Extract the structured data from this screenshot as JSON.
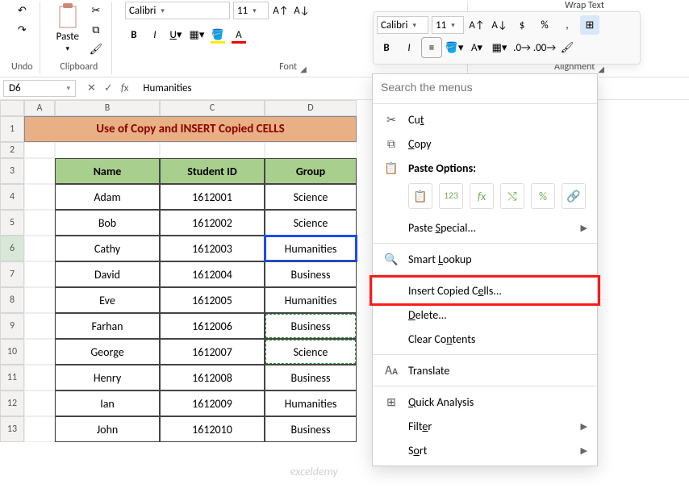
{
  "ribbon": {
    "undo_label": "Undo",
    "clipboard_label": "Clipboard",
    "paste_label": "Paste",
    "font_label": "Font",
    "alignment_label": "Alignment",
    "font_name": "Calibri",
    "font_size": "11",
    "wrap_text": "Wrap Text"
  },
  "mini": {
    "font": "Calibri",
    "size": "11"
  },
  "formula": {
    "name_box": "D6",
    "value": "Humanities"
  },
  "sheet": {
    "title": "Use of Copy and INSERT Copied CELLS",
    "columns": [
      "Name",
      "Student ID",
      "Group"
    ],
    "rows": [
      {
        "name": "Adam",
        "id": "1612001",
        "group": "Science"
      },
      {
        "name": "Bob",
        "id": "1612002",
        "group": "Science"
      },
      {
        "name": "Cathy",
        "id": "1612003",
        "group": "Humanities"
      },
      {
        "name": "David",
        "id": "1612004",
        "group": "Business"
      },
      {
        "name": "Eve",
        "id": "1612005",
        "group": "Humanities"
      },
      {
        "name": "Farhan",
        "id": "1612006",
        "group": "Business"
      },
      {
        "name": "George",
        "id": "1612007",
        "group": "Science"
      },
      {
        "name": "Henry",
        "id": "1612008",
        "group": "Business"
      },
      {
        "name": "Ian",
        "id": "1612009",
        "group": "Humanities"
      },
      {
        "name": "John",
        "id": "1612010",
        "group": "Business"
      }
    ],
    "col_letters": [
      "A",
      "B",
      "C",
      "D"
    ],
    "row_nums": [
      "1",
      "2",
      "3",
      "4",
      "5",
      "6",
      "7",
      "8",
      "9",
      "10",
      "11",
      "12",
      "13"
    ]
  },
  "ctx": {
    "search_ph": "Search the menus",
    "cut": "Cut",
    "copy": "Copy",
    "paste_options": "Paste Options:",
    "paste_special": "Paste Special...",
    "smart_lookup": "Smart Lookup",
    "insert_copied": "Insert Copied Cells...",
    "delete": "Delete...",
    "clear": "Clear Contents",
    "translate": "Translate",
    "quick_analysis": "Quick Analysis",
    "filter": "Filter",
    "sort": "Sort"
  },
  "watermark": "exceldemy"
}
